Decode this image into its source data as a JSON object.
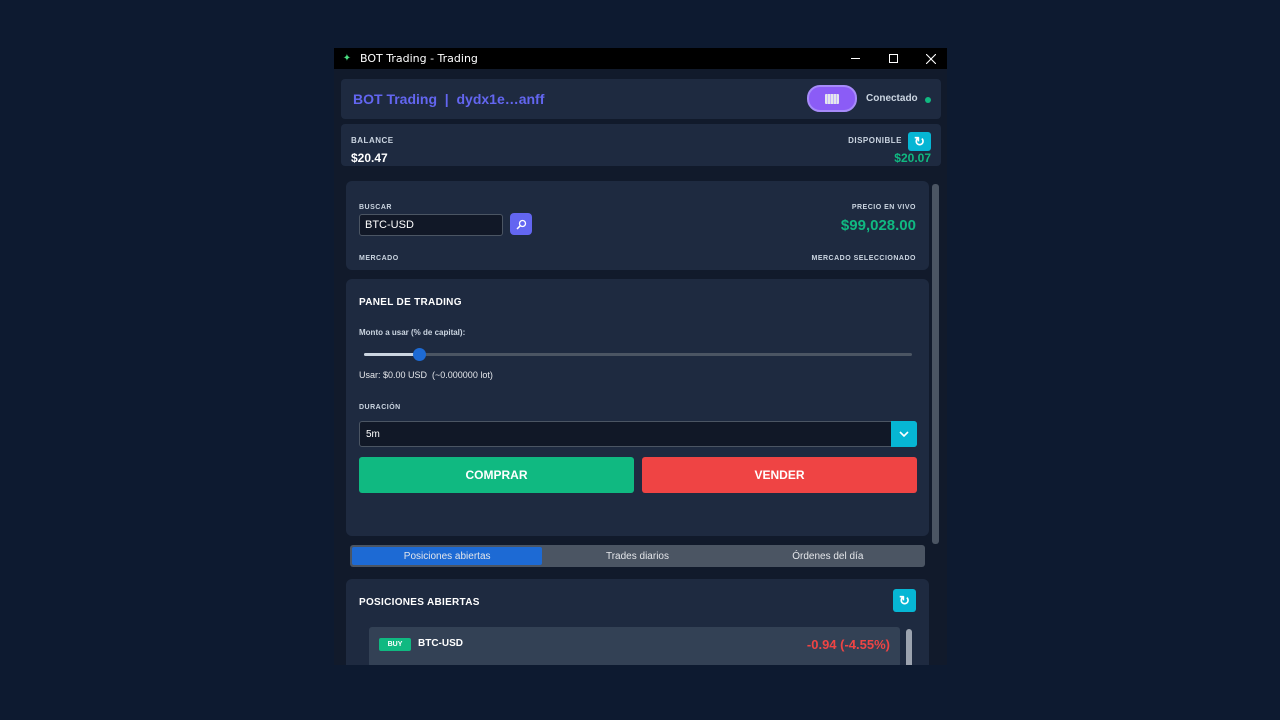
{
  "window": {
    "title": "BOT Trading - Trading",
    "app_icon": "bot-icon"
  },
  "header": {
    "brand": "BOT Trading  |  dydx1e…anff",
    "wallet_icon": "wallet-icon",
    "status": "Conectado",
    "status_color": "#10b981"
  },
  "balance": {
    "label": "BALANCE",
    "value": "$20.47",
    "available_label": "DISPONIBLE",
    "available_value": "$20.07"
  },
  "search": {
    "label": "BUSCAR",
    "value": "BTC-USD",
    "market_label": "MERCADO",
    "price_label": "PRECIO EN VIVO",
    "price": "$99,028.00",
    "selected_label": "MERCADO SELECCIONADO"
  },
  "trading": {
    "title": "PANEL DE TRADING",
    "amount_label": "Monto a usar (% de capital):",
    "slider_percent": 10,
    "usage_text": "Usar: $0.00 USD  (~0.000000 lot)",
    "duration_label": "DURACIÓN",
    "duration_value": "5m",
    "buy_label": "COMPRAR",
    "sell_label": "VENDER"
  },
  "tabs": [
    {
      "label": "Posiciones abiertas",
      "active": true
    },
    {
      "label": "Trades diarios",
      "active": false
    },
    {
      "label": "Órdenes del día",
      "active": false
    }
  ],
  "positions": {
    "title": "POSICIONES ABIERTAS",
    "items": [
      {
        "side": "BUY",
        "symbol": "BTC-USD",
        "pnl": "-0.94 (-4.55%)"
      }
    ]
  },
  "colors": {
    "accent": "#6366f1",
    "buy": "#10b981",
    "sell": "#ef4444",
    "cyan": "#06b6d4"
  }
}
